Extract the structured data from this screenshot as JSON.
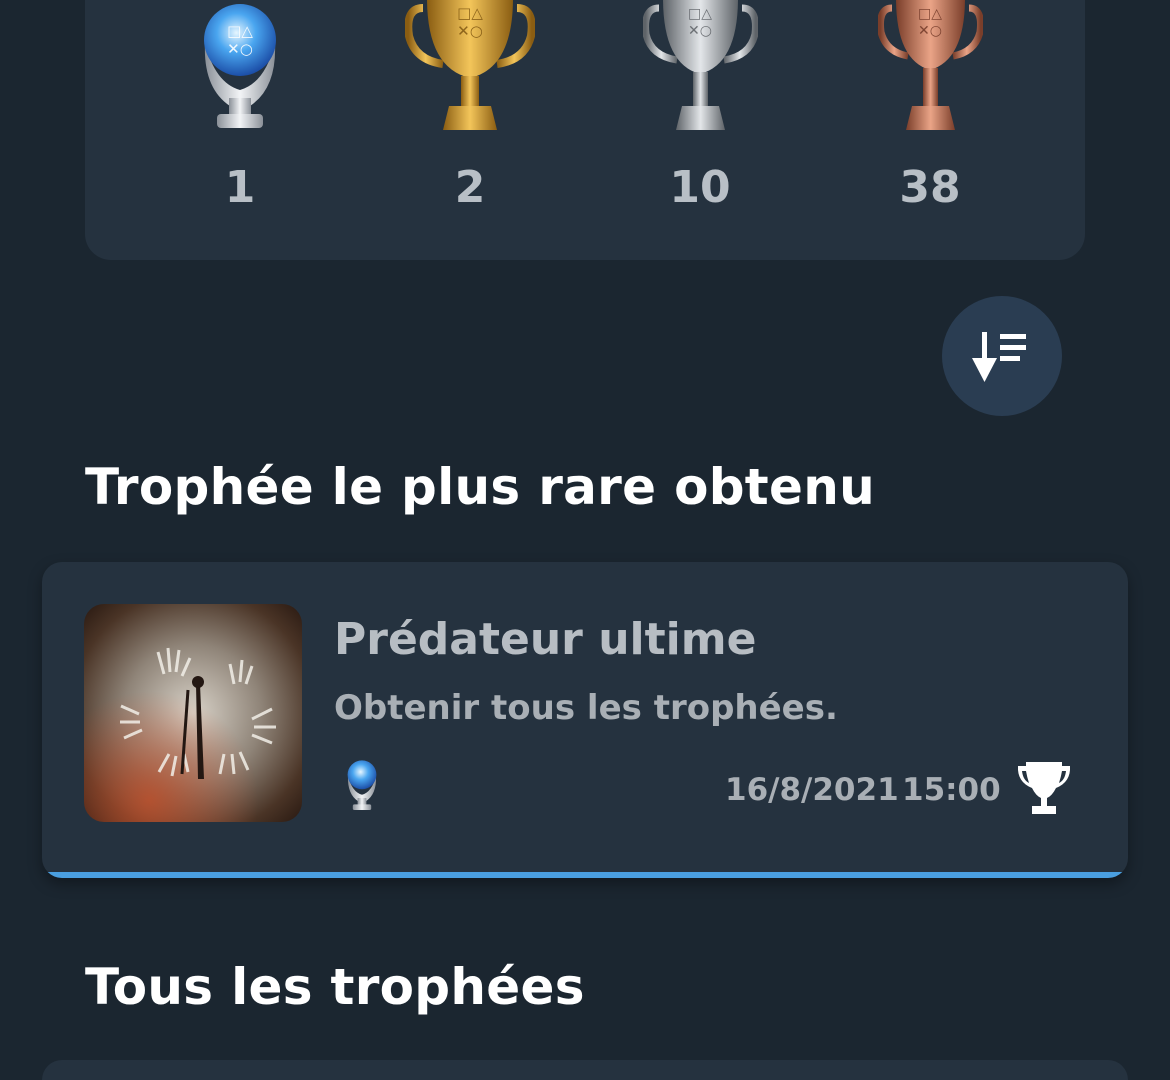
{
  "summary": {
    "trophies": [
      {
        "grade": "platinum",
        "count": "1",
        "icon": "platinum-trophy-icon"
      },
      {
        "grade": "gold",
        "count": "2",
        "icon": "gold-trophy-icon"
      },
      {
        "grade": "silver",
        "count": "10",
        "icon": "silver-trophy-icon"
      },
      {
        "grade": "bronze",
        "count": "38",
        "icon": "bronze-trophy-icon"
      }
    ]
  },
  "sort_button": {
    "icon": "sort-descending-icon"
  },
  "rarest_section": {
    "title": "Trophée le plus rare obtenu"
  },
  "rarest_trophy": {
    "name": "Prédateur ultime",
    "description": "Obtenir tous les trophées.",
    "grade_icon": "platinum-trophy-icon",
    "date": "16/8/2021",
    "time": "15:00",
    "earned_icon": "trophy-earned-icon",
    "accent_color": "#4a9fe0"
  },
  "all_section": {
    "title": "Tous les trophées"
  },
  "colors": {
    "background": "#1b2630",
    "card": "#25323f",
    "sort_button": "#2a3d52"
  }
}
